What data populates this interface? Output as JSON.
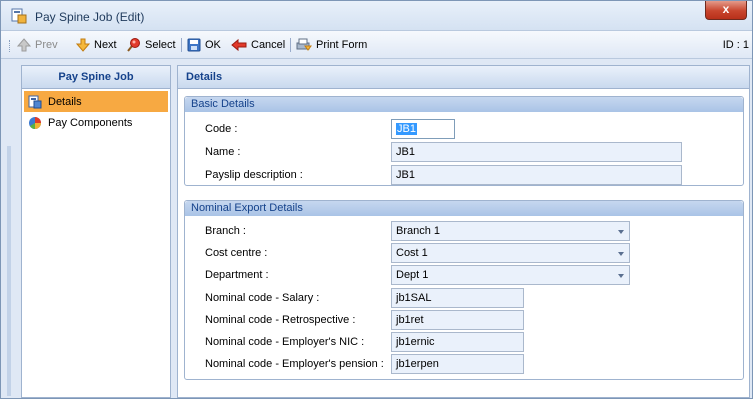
{
  "window": {
    "title": "Pay Spine Job (Edit)",
    "close_glyph": "x"
  },
  "toolbar": {
    "prev_label": "Prev",
    "next_label": "Next",
    "select_label": "Select",
    "ok_label": "OK",
    "cancel_label": "Cancel",
    "print_label": "Print Form",
    "id_text": "ID : 1"
  },
  "nav": {
    "header": "Pay Spine Job",
    "items": [
      {
        "label": "Details",
        "icon": "details-icon",
        "selected": true
      },
      {
        "label": "Pay Components",
        "icon": "pie-chart-icon",
        "selected": false
      }
    ]
  },
  "details": {
    "header": "Details",
    "basic": {
      "title": "Basic Details",
      "code_label": "Code :",
      "code_value": "JB1",
      "name_label": "Name :",
      "name_value": "JB1",
      "payslip_label": "Payslip description :",
      "payslip_value": "JB1"
    },
    "nominal": {
      "title": "Nominal Export Details",
      "branch_label": "Branch :",
      "branch_value": "Branch 1",
      "cost_label": "Cost centre :",
      "cost_value": "Cost 1",
      "dept_label": "Department :",
      "dept_value": "Dept 1",
      "salary_label": "Nominal code - Salary :",
      "salary_value": "jb1SAL",
      "retro_label": "Nominal code - Retrospective :",
      "retro_value": "jb1ret",
      "nic_label": "Nominal code - Employer's NIC :",
      "nic_value": "jb1ernic",
      "pension_label": "Nominal code - Employer's pension :",
      "pension_value": "jb1erpen"
    }
  }
}
